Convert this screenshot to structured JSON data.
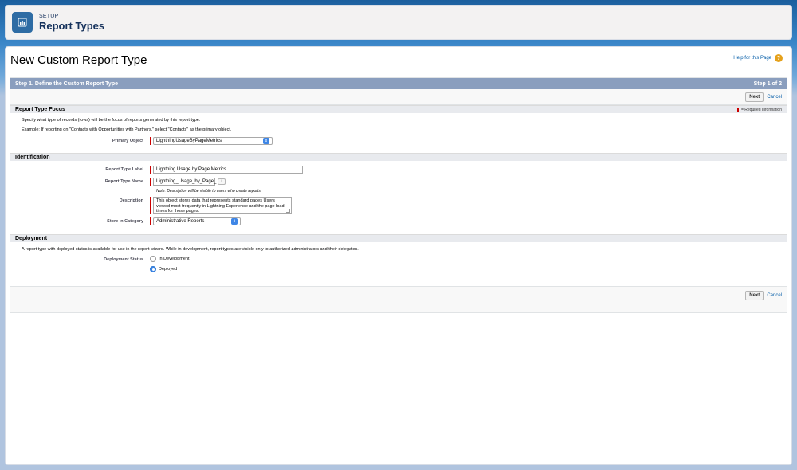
{
  "header": {
    "setup_label": "SETUP",
    "title": "Report Types",
    "icon": "report-icon"
  },
  "page": {
    "title": "New Custom Report Type",
    "help_link": "Help for this Page"
  },
  "step": {
    "title": "Step 1. Define the Custom Report Type",
    "indicator": "Step 1 of 2"
  },
  "buttons": {
    "next": "Next",
    "cancel": "Cancel"
  },
  "focus_section": {
    "title": "Report Type Focus",
    "required_info": "= Required Information",
    "description": "Specify what type of records (rows) will be the focus of reports generated by this report type.",
    "example": "Example: If reporting on \"Contacts with Opportunities with Partners,\" select \"Contacts\" as the primary object.",
    "primary_object_label": "Primary Object",
    "primary_object_value": "LightningUsageByPageMetrics"
  },
  "identification_section": {
    "title": "Identification",
    "label_field_label": "Report Type Label",
    "label_field_value": "Lightning Usage by Page Metrics",
    "name_field_label": "Report Type Name",
    "name_field_value": "Lightning_Usage_by_Page_",
    "name_info": "i",
    "note": "Note: Description will be visible to users who create reports.",
    "description_label": "Description",
    "description_value": "This object stores data that represents standard pages Users viewed most frequently in Lightning Experience and the page load times for those pages.",
    "category_label": "Store in Category",
    "category_value": "Administrative Reports"
  },
  "deployment_section": {
    "title": "Deployment",
    "description": "A report type with deployed status is available for use in the report wizard. While in development, report types are visible only to authorized administrators and their delegates.",
    "status_label": "Deployment Status",
    "option_dev": "In Development",
    "option_deployed": "Deployed",
    "selected": "Deployed"
  }
}
